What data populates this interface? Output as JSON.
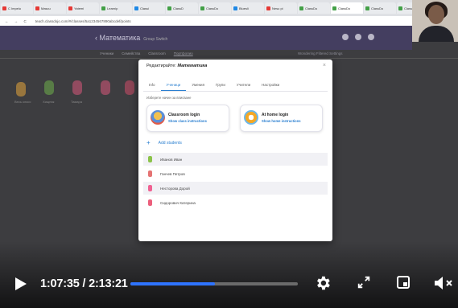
{
  "browser": {
    "tabs": [
      "С Impelu",
      "Mascu",
      "Yatemi",
      "Learnip",
      "Classi",
      "ClassD",
      "ClassDo",
      "Bluesli",
      "Nesu pi",
      "ClassDo",
      "ClassDo",
      "ClassDo",
      "ClassDo",
      "Bluesli"
    ],
    "tab_colors": [
      "#e53935",
      "#e53935",
      "#e53935",
      "#43a047",
      "#1e88e5",
      "#43a047",
      "#43a047",
      "#1e88e5",
      "#e53935",
      "#43a047",
      "#43a047",
      "#43a047",
      "#43a047",
      "#1e88e5"
    ],
    "active_tab_index": 10,
    "url": "teach.classdojo.com/#/classes/5a1234567890abcdef/points",
    "nav": "← → C"
  },
  "app": {
    "title": "Математика",
    "subtitle": "Group  Switch",
    "bg_tabs": [
      "Ученики",
      "Семейства",
      "Classroom",
      "Портфолио"
    ],
    "bg_right": "Wondering   Filtered Settings",
    "bg_students": [
      "Весь класс",
      "Хищник",
      "Тамара",
      "Несс",
      "Несс"
    ]
  },
  "dialog": {
    "title_prefix": "Редактирайте:",
    "title_class": "Математика",
    "close": "×",
    "tabs": [
      "Info",
      "Ученици",
      "Умения",
      "Групи",
      "Учители",
      "Настройки"
    ],
    "active_tab": 1,
    "instruction": "Изберете начин за вписване",
    "cards": [
      {
        "title": "Classroom login",
        "link": "Show class instructions",
        "color": "#e05a47"
      },
      {
        "title": "At home login",
        "link": "Show home instructions",
        "color": "#f3a826"
      }
    ],
    "add_students": "Add students",
    "students": [
      {
        "name": "Иванов Иван",
        "color": "#8bc34a"
      },
      {
        "name": "Ганчев Петров",
        "color": "#e57373"
      },
      {
        "name": "Несторова Дорой",
        "color": "#f06292"
      },
      {
        "name": "Сидорович Катерина",
        "color": "#ec5f7c"
      }
    ]
  },
  "player": {
    "current_time": "1:07:35",
    "duration": "2:13:21",
    "progress": 0.507,
    "buffered": 0.6,
    "accent": "#2f74ff"
  }
}
